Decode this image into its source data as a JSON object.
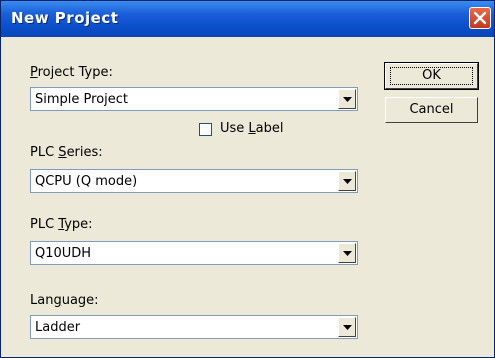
{
  "window": {
    "title": "New Project"
  },
  "fields": {
    "project_type": {
      "label_before": "",
      "accel": "P",
      "label_after": "roject Type:",
      "value": "Simple Project"
    },
    "use_label": {
      "label_before": "Use ",
      "accel": "L",
      "label_after": "abel",
      "checked": false
    },
    "plc_series": {
      "label_before": "PLC ",
      "accel": "S",
      "label_after": "eries:",
      "value": "QCPU (Q mode)"
    },
    "plc_type": {
      "label_before": "PLC ",
      "accel": "T",
      "label_after": "ype:",
      "value": "Q10UDH"
    },
    "language": {
      "label_before": "Lan",
      "accel": "g",
      "label_after": "uage:",
      "value": "Ladder"
    }
  },
  "buttons": {
    "ok": "OK",
    "cancel": "Cancel"
  },
  "icons": {
    "close": "close-icon",
    "dropdown": "dropdown-arrow-icon"
  },
  "colors": {
    "titlebar": "#0a46b8",
    "close": "#c4381e",
    "dialog_bg": "#ece9d8"
  }
}
